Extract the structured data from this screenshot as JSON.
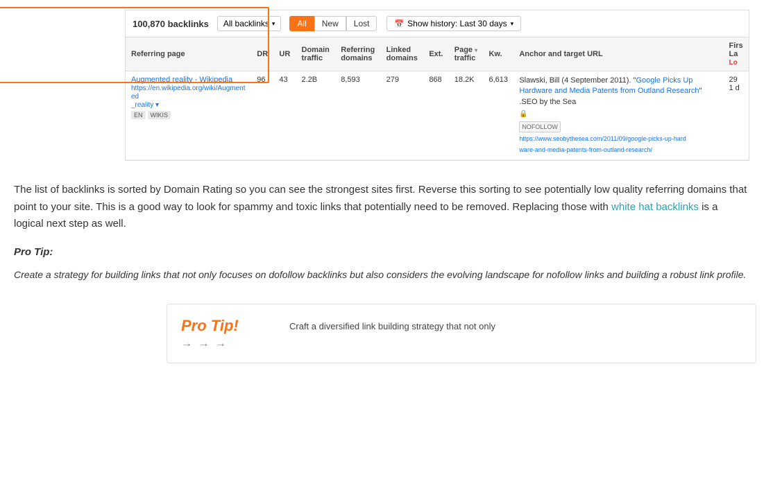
{
  "table": {
    "backlink_count": "100,870 backlinks",
    "all_backlinks_dropdown": "All backlinks",
    "tabs": [
      {
        "label": "All",
        "active": true
      },
      {
        "label": "New",
        "active": false
      },
      {
        "label": "Lost",
        "active": false
      }
    ],
    "history_button": "Show history: Last 30 days",
    "columns": [
      {
        "label": "Referring page"
      },
      {
        "label": "DR"
      },
      {
        "label": "UR"
      },
      {
        "label": "Domain traffic"
      },
      {
        "label": "Referring domains"
      },
      {
        "label": "Linked domains"
      },
      {
        "label": "Ext."
      },
      {
        "label": "Page traffic"
      },
      {
        "label": "Kw."
      },
      {
        "label": "Anchor and target URL"
      },
      {
        "label": "First / Last seen"
      }
    ],
    "rows": [
      {
        "page_title": "Augmented reality - Wikipedia",
        "page_url": "https://en.wikipedia.org/wiki/Augmented_reality",
        "tags": [
          "EN",
          "WIKIS"
        ],
        "dr": "96",
        "ur": "43",
        "domain_traffic": "2.2B",
        "referring_domains": "8,593",
        "linked_domains": "279",
        "ext": "868",
        "page_traffic": "18.2K",
        "kw": "6,613",
        "anchor_text": "Slawski, Bill (4 September 2011). \"Google Picks Up Hardware and Media Patents from Outland Research\" .SEO by the Sea",
        "anchor_link_text": "Google Picks Up Hardware and Media Patents from Outland Research",
        "nofollow": "NOFOLLOW",
        "anchor_url": "https://www.seobythesea.com/2011/09/google-picks-up-hard-ware-and-media-patents-from-outland-research/",
        "first_seen": "29",
        "last_seen": "1 d",
        "last_status": "Lost"
      }
    ]
  },
  "body": {
    "paragraph1": "The list of backlinks is sorted by Domain Rating so you can see the strongest sites first. Reverse this sorting to see potentially low quality referring domains that point to your site. This is a good way to look for spammy and toxic links that potentially need to be removed. Replacing those with white hat backlinks is a logical next step as well.",
    "inline_link_text": "white hat backlinks",
    "pro_tip_label": "Pro Tip:",
    "pro_tip_body": "Create a strategy for building links that not only focuses on dofollow backlinks but also considers the evolving landscape for nofollow links and building a robust link profile."
  },
  "pro_tip_card": {
    "title": "Pro Tip!",
    "arrows": "→ → →",
    "text": "Craft a diversified link building strategy that not only"
  }
}
